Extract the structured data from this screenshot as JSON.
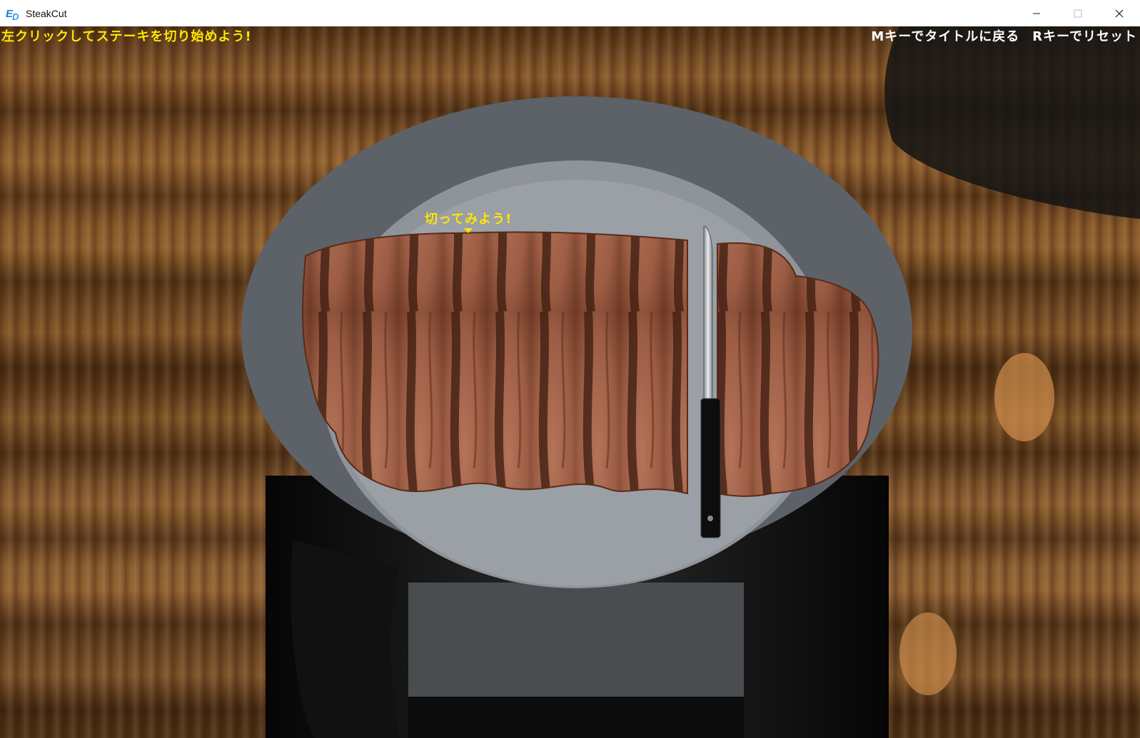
{
  "window": {
    "title": "SteakCut",
    "icon": "ed-app-icon",
    "controls": [
      "minimize-icon",
      "maximize-icon",
      "close-icon"
    ]
  },
  "hud": {
    "instruction": "左クリックしてステーキを切り始めよう!",
    "menu_hint": "Mキーでタイトルに戻る",
    "reset_hint": "Rキーでリセット"
  },
  "scene": {
    "cut_hint": "切ってみよう!",
    "hint_color": "#ffe600",
    "plate_color": "#5c6268",
    "steak_color": "#a8674a",
    "objects": [
      "wooden-table",
      "pedestal",
      "plate",
      "steak-left-piece",
      "steak-right-piece",
      "knife"
    ]
  }
}
